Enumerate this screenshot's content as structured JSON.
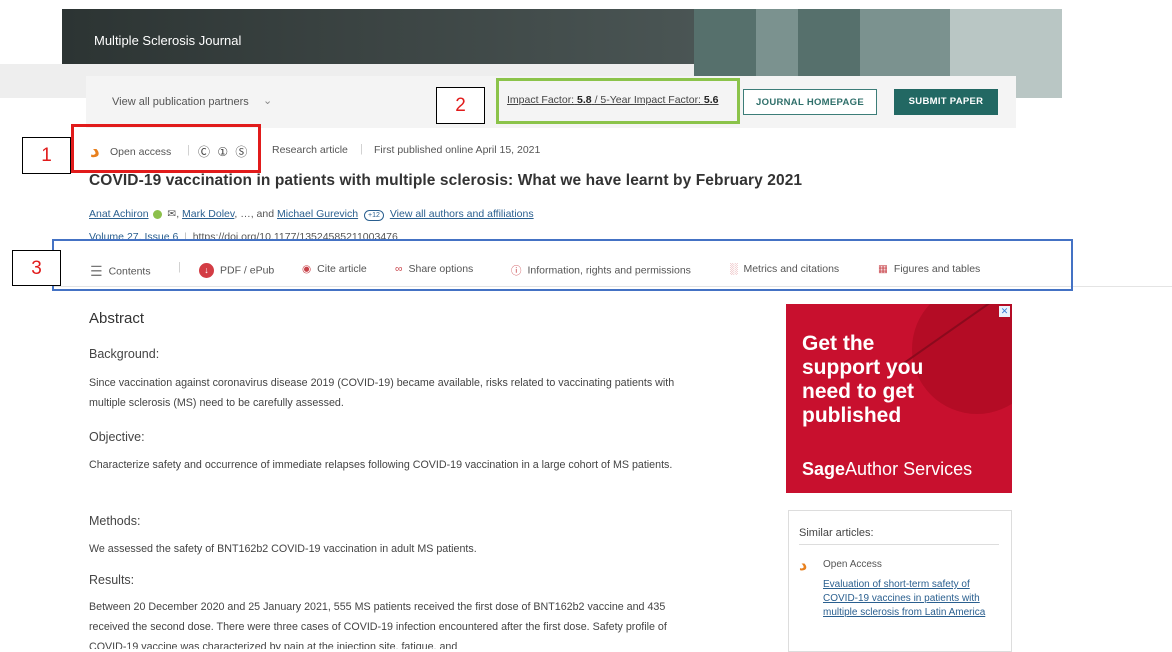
{
  "journal": {
    "name": "Multiple Sclerosis Journal"
  },
  "partners": {
    "label": "View all publication partners",
    "chevron": "chevron-down-icon"
  },
  "impact": {
    "label1": "Impact Factor:",
    "value1": "5.8",
    "separator": "/",
    "label2": "5-Year Impact Factor:",
    "value2": "5.6"
  },
  "buttons": {
    "homepage": "JOURNAL HOMEPAGE",
    "submit": "SUBMIT PAPER"
  },
  "meta": {
    "open_access": "Open access",
    "oa_icon": "open-access-icon",
    "license_icons": "Ⓒ ① Ⓢ",
    "article_type": "Research article",
    "published": "First published online April 15, 2021"
  },
  "article": {
    "title": "COVID-19 vaccination in patients with multiple sclerosis: What we have learnt by February 2021",
    "author1": "Anat Achiron",
    "author2": "Mark Dolev",
    "author_sep": ", ",
    "dots": ", …, ",
    "and": " and ",
    "author3": "Michael Gurevich",
    "more_badge": "+12",
    "view_all": "View all authors and affiliations",
    "volume": "Volume 27, Issue 6",
    "doi": "https://doi.org/10.1177/13524585211003476"
  },
  "toolbar": {
    "contents": "Contents",
    "pdf": "PDF / ePub",
    "cite": "Cite article",
    "share": "Share options",
    "info": "Information, rights and permissions",
    "metrics": "Metrics and citations",
    "figures": "Figures and tables"
  },
  "annotations": {
    "n1": "1",
    "n2": "2",
    "n3": "3"
  },
  "abstract": {
    "heading": "Abstract",
    "background_title": "Background:",
    "background": "Since vaccination against coronavirus disease 2019 (COVID-19) became available, risks related to vaccinating patients with multiple sclerosis (MS) need to be carefully assessed.",
    "objective_title": "Objective:",
    "objective": "Characterize safety and occurrence of immediate relapses following COVID-19 vaccination in a large cohort of MS patients.",
    "methods_title": "Methods:",
    "methods": "We assessed the safety of BNT162b2 COVID-19 vaccination in adult MS patients.",
    "results_title": "Results:",
    "results": "Between 20 December 2020 and 25 January 2021, 555 MS patients received the first dose of BNT162b2 vaccine and 435 received the second dose. There were three cases of COVID-19 infection encountered after the first dose. Safety profile of COVID-19 vaccine was characterized by pain at the injection site, fatigue, and"
  },
  "ad": {
    "headline": "Get the\nsupport you\nneed to get\npublished",
    "brand_bold": "Sage",
    "brand_rest": "Author Services",
    "close": "✕"
  },
  "similar": {
    "title": "Similar articles:",
    "oa_label": "Open Access",
    "link": "Evaluation of short-term safety of COVID-19 vaccines in patients with multiple sclerosis from Latin America"
  },
  "colors": {
    "brand_teal": "#226863",
    "oa_orange": "#e8801e",
    "link_blue": "#2a5f8f",
    "ad_red": "#c8102e"
  }
}
